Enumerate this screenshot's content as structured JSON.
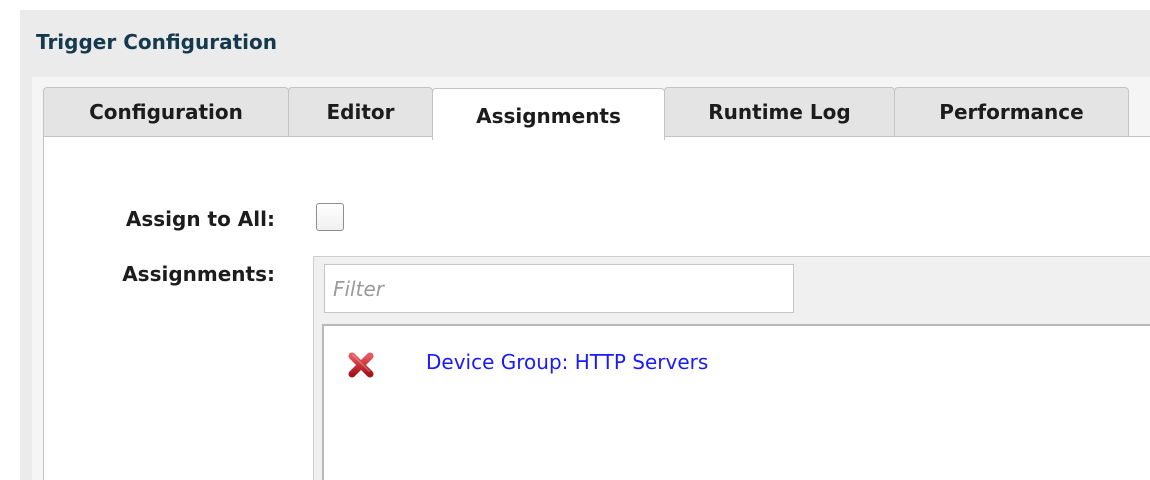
{
  "panel": {
    "title": "Trigger Configuration"
  },
  "tabs": [
    {
      "label": "Configuration",
      "active": false
    },
    {
      "label": "Editor",
      "active": false
    },
    {
      "label": "Assignments",
      "active": true
    },
    {
      "label": "Runtime Log",
      "active": false
    },
    {
      "label": "Performance",
      "active": false
    }
  ],
  "form": {
    "assign_all_label": "Assign to All:",
    "assign_all_checked": false,
    "assignments_label": "Assignments:",
    "filter": {
      "placeholder": "Filter",
      "value": ""
    },
    "items": [
      {
        "label": "Device Group: HTTP Servers",
        "icon": "remove-x-icon"
      }
    ]
  },
  "colors": {
    "title": "#153a4d",
    "link": "#1a1aff",
    "remove_icon": "#c8232a",
    "panel_bg": "#ebebeb",
    "tab_bg": "#e4e4e4"
  }
}
